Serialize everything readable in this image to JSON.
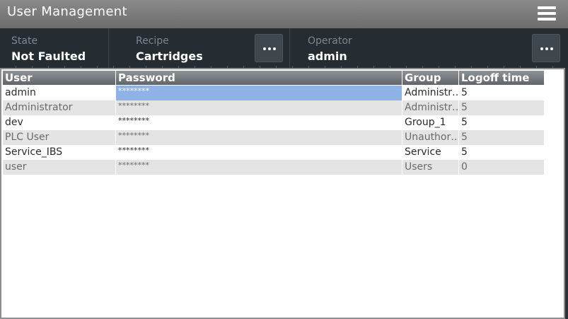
{
  "header": {
    "title": "User Management",
    "menu_icon": "hamburger-icon"
  },
  "info": {
    "state_label": "State",
    "state_value": "Not Faulted",
    "recipe_label": "Recipe",
    "recipe_value": "Cartridges",
    "operator_label": "Operator",
    "operator_value": "admin"
  },
  "table": {
    "columns": [
      "User",
      "Password",
      "Group",
      "Logoff time"
    ],
    "rows": [
      {
        "user": "admin",
        "password": "********",
        "group": "Administr…",
        "logoff": "5"
      },
      {
        "user": "Administrator",
        "password": "********",
        "group": "Administr…",
        "logoff": "5"
      },
      {
        "user": "dev",
        "password": "********",
        "group": "Group_1",
        "logoff": "5"
      },
      {
        "user": "PLC User",
        "password": "********",
        "group": "Unauthor…",
        "logoff": "5"
      },
      {
        "user": "Service_IBS",
        "password": "********",
        "group": "Service",
        "logoff": "5"
      },
      {
        "user": "user",
        "password": "********",
        "group": "Users",
        "logoff": "0"
      }
    ],
    "selected_row": 0
  },
  "colors": {
    "title_bg": "#7a7a7a",
    "panel_bg": "#262d32",
    "selection": "#8fb3e6"
  }
}
